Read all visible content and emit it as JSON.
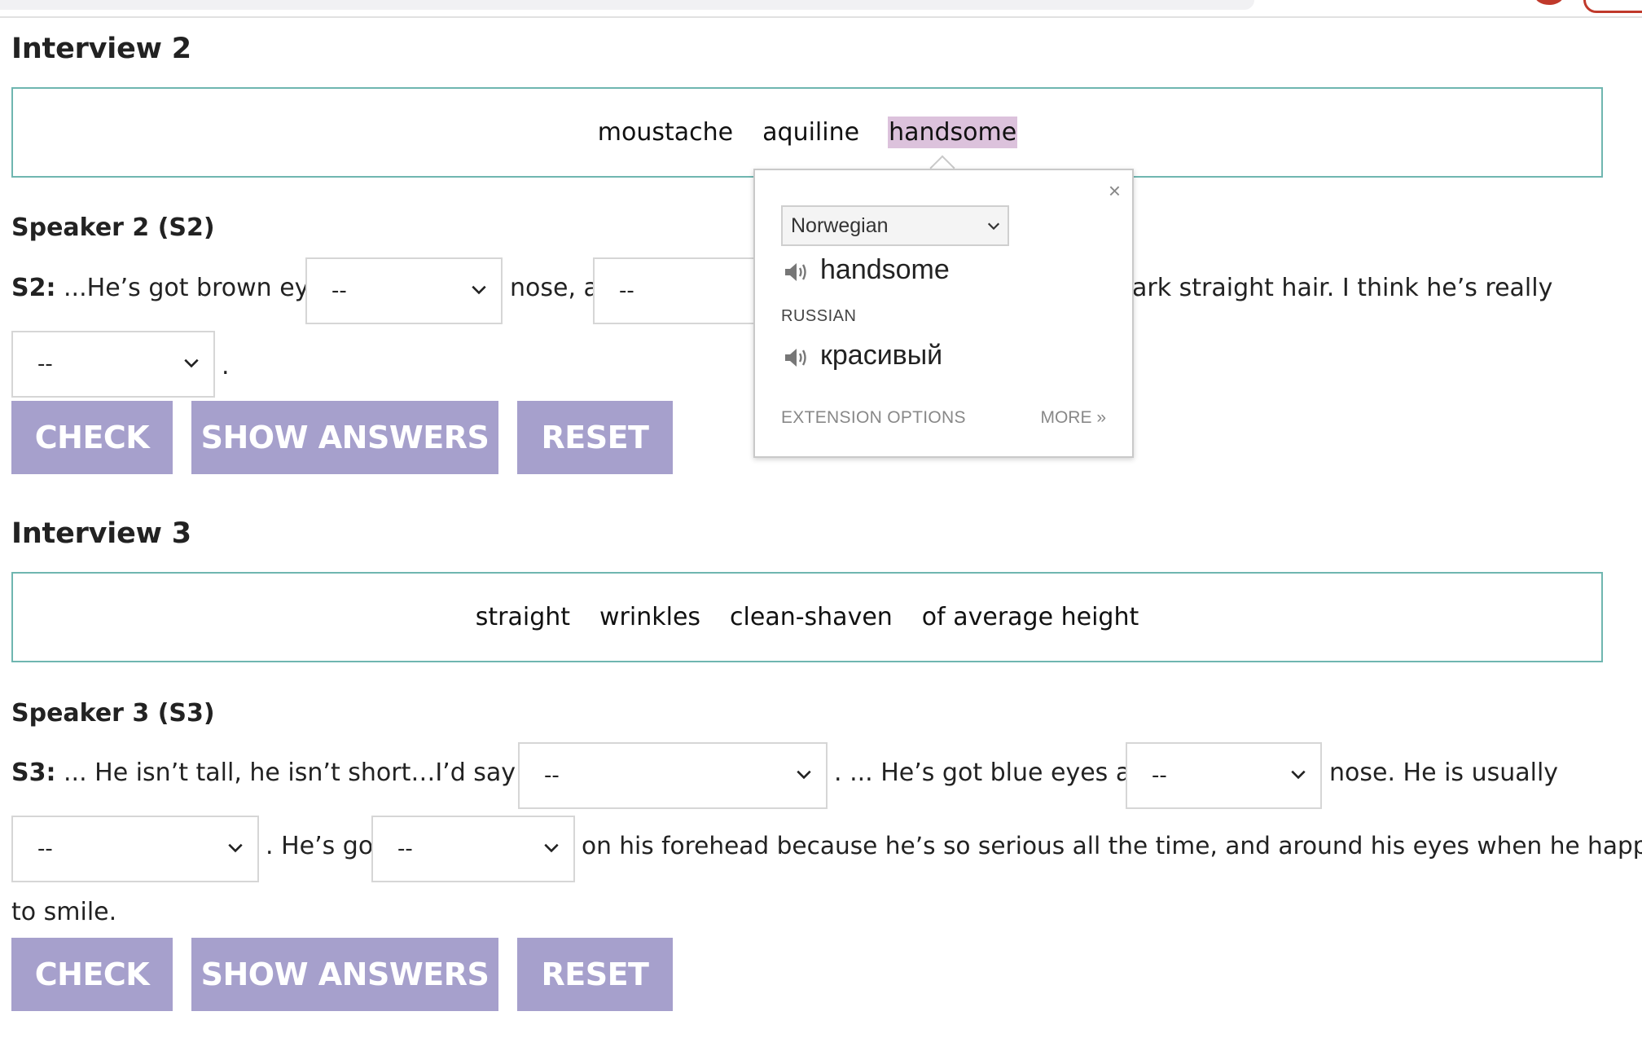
{
  "interview2": {
    "title": "Interview 2",
    "words": [
      "moustache",
      "aquiline",
      "handsome"
    ],
    "speaker_heading": "Speaker 2 (S2)",
    "speaker_tag": "S2:",
    "text1": " ...He’s got brown eyes, ",
    "text2": "nose, a",
    "text3": "ark straight hair. I think he’s really",
    "end": ".",
    "select_value": "--"
  },
  "interview3": {
    "title": "Interview 3",
    "words": [
      "straight",
      "wrinkles",
      "clean-shaven",
      "of average height"
    ],
    "speaker_heading": "Speaker 3 (S3)",
    "speaker_tag": "S3:",
    "text1": " ... He isn’t tall, he isn’t short…I’d say he is",
    "text2": ". ... He’s got blue eyes and",
    "text3": "nose. He is usually",
    "text4": ". He’s got",
    "text5": "on his forehead because he’s so serious all the time, and around his eyes when he happens",
    "text6": "to smile.",
    "select_value": "--"
  },
  "buttons": {
    "check": "CHECK",
    "show_answers": "SHOW ANSWERS",
    "reset": "RESET"
  },
  "translate_popup": {
    "close": "×",
    "source_language": "Norwegian",
    "source_word": "handsome",
    "target_language": "RUSSIAN",
    "target_word": "красивый",
    "extension_options": "EXTENSION OPTIONS",
    "more": "MORE »"
  },
  "colors": {
    "button_bg": "#a6a0cc",
    "word_box_border": "#6fb6b0",
    "highlight": "#dcc2dc"
  }
}
